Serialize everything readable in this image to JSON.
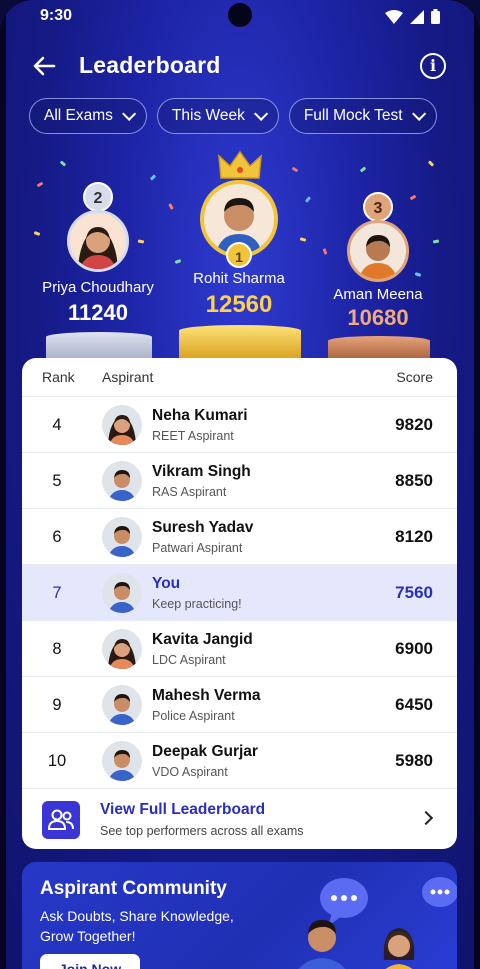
{
  "status": {
    "time": "9:30"
  },
  "header": {
    "title": "Leaderboard",
    "info_glyph": "i"
  },
  "filters": [
    {
      "label": "All Exams"
    },
    {
      "label": "This Week"
    },
    {
      "label": "Full Mock Test"
    }
  ],
  "podium": {
    "first": {
      "rank": "1",
      "name": "Rohit Sharma",
      "score": "12560"
    },
    "second": {
      "rank": "2",
      "name": "Priya Choudhary",
      "score": "11240"
    },
    "third": {
      "rank": "3",
      "name": "Aman Meena",
      "score": "10680"
    }
  },
  "table": {
    "headers": {
      "rank": "Rank",
      "aspirant": "Aspirant",
      "score": "Score"
    },
    "rows": [
      {
        "rank": "4",
        "name": "Neha Kumari",
        "role": "REET Aspirant",
        "score": "9820",
        "gender": "f"
      },
      {
        "rank": "5",
        "name": "Vikram Singh",
        "role": "RAS Aspirant",
        "score": "8850",
        "gender": "m"
      },
      {
        "rank": "6",
        "name": "Suresh Yadav",
        "role": "Patwari Aspirant",
        "score": "8120",
        "gender": "m"
      },
      {
        "rank": "7",
        "name": "You",
        "role": "Keep practicing!",
        "score": "7560",
        "gender": "m",
        "highlight": true
      },
      {
        "rank": "8",
        "name": "Kavita Jangid",
        "role": "LDC Aspirant",
        "score": "6900",
        "gender": "f"
      },
      {
        "rank": "9",
        "name": "Mahesh Verma",
        "role": "Police Aspirant",
        "score": "6450",
        "gender": "m"
      },
      {
        "rank": "10",
        "name": "Deepak Gurjar",
        "role": "VDO Aspirant",
        "score": "5980",
        "gender": "m"
      }
    ]
  },
  "view_full": {
    "title": "View Full Leaderboard",
    "subtitle": "See top performers across all exams"
  },
  "community": {
    "title": "Aspirant Community",
    "subtitle": "Ask Doubts, Share Knowledge, Grow Together!",
    "button": "Join Now"
  },
  "colors": {
    "accent": "#2a2fb8",
    "gold": "#f2c43a",
    "silver": "#c9cfe0",
    "bronze": "#d8895a",
    "highlight_row": "#e5e8fd"
  }
}
